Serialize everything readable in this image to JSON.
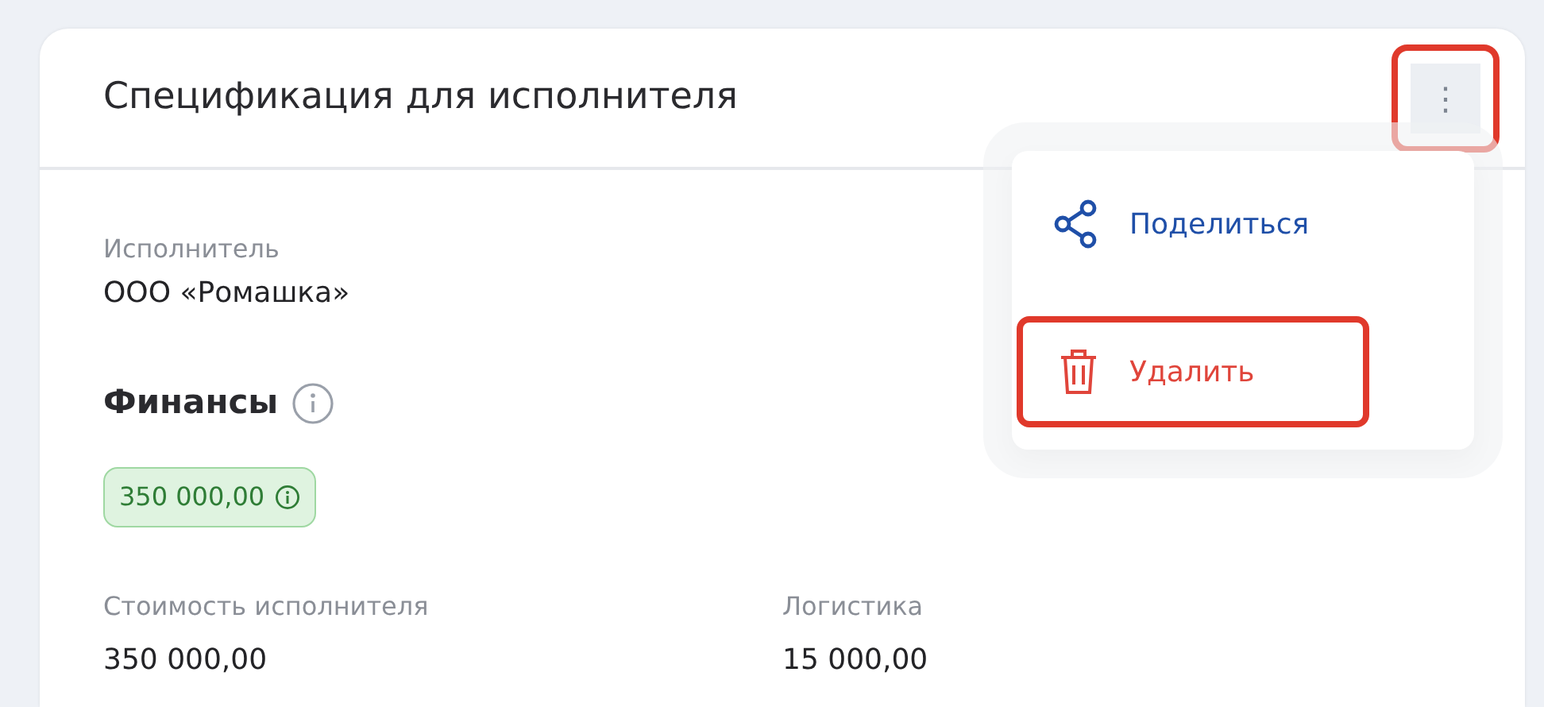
{
  "card": {
    "title": "Спецификация для исполнителя",
    "more_button": {
      "label": "⋮",
      "highlighted": true
    }
  },
  "menu": {
    "items": [
      {
        "kind": "share",
        "label": "Поделиться",
        "highlighted": false
      },
      {
        "kind": "delete",
        "label": "Удалить",
        "highlighted": true
      }
    ]
  },
  "contractor": {
    "label": "Исполнитель",
    "value": "ООО «Ромашка»"
  },
  "finance": {
    "heading": "Финансы",
    "total_badge": "350 000,00",
    "fields": [
      {
        "label": "Стоимость исполнителя",
        "value": "350 000,00"
      },
      {
        "label": "Логистика",
        "value": "15 000,00"
      }
    ]
  }
}
